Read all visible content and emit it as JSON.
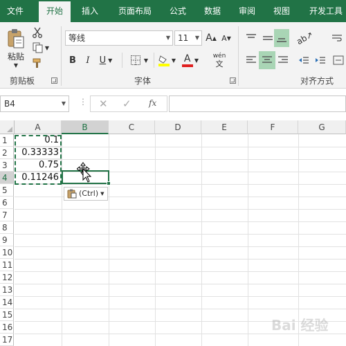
{
  "ribbon_tabs": [
    {
      "label": "文件"
    },
    {
      "label": "开始"
    },
    {
      "label": "插入"
    },
    {
      "label": "页面布局"
    },
    {
      "label": "公式"
    },
    {
      "label": "数据"
    },
    {
      "label": "审阅"
    },
    {
      "label": "视图"
    },
    {
      "label": "开发工具"
    }
  ],
  "active_tab": "开始",
  "clipboard": {
    "paste_label": "粘贴",
    "group_label": "剪贴板"
  },
  "font": {
    "font_name": "等线",
    "font_size": "11",
    "bold": "B",
    "italic": "I",
    "underline": "U",
    "grow_font": "A",
    "shrink_font": "A",
    "font_color_glyph": "A",
    "pinyin_glyph": "wén",
    "pinyin_sub": "文",
    "group_label": "字体"
  },
  "alignment": {
    "group_label": "对齐方式"
  },
  "formula_bar": {
    "name_box": "B4",
    "fx_label": "fx",
    "formula_value": ""
  },
  "grid": {
    "columns": [
      "A",
      "B",
      "C",
      "D",
      "E",
      "F",
      "G"
    ],
    "selected_column": "B",
    "rows": [
      "1",
      "2",
      "3",
      "4",
      "5",
      "6",
      "7",
      "8",
      "9",
      "10",
      "11",
      "12",
      "13",
      "14",
      "15",
      "16",
      "17"
    ],
    "selected_row": "4",
    "column_a_values": [
      "0.1",
      "0.33333",
      "0.75",
      "0.11246"
    ]
  },
  "paste_options": {
    "label": "(Ctrl)"
  },
  "watermark": {
    "text": "Bai 经验"
  },
  "colors": {
    "excel_green": "#217346",
    "ribbon_bg": "#f3f3f3",
    "selected_align_bg": "#a9d5b5",
    "font_color_red": "#e02020",
    "highlight_yellow": "#ffff00"
  }
}
